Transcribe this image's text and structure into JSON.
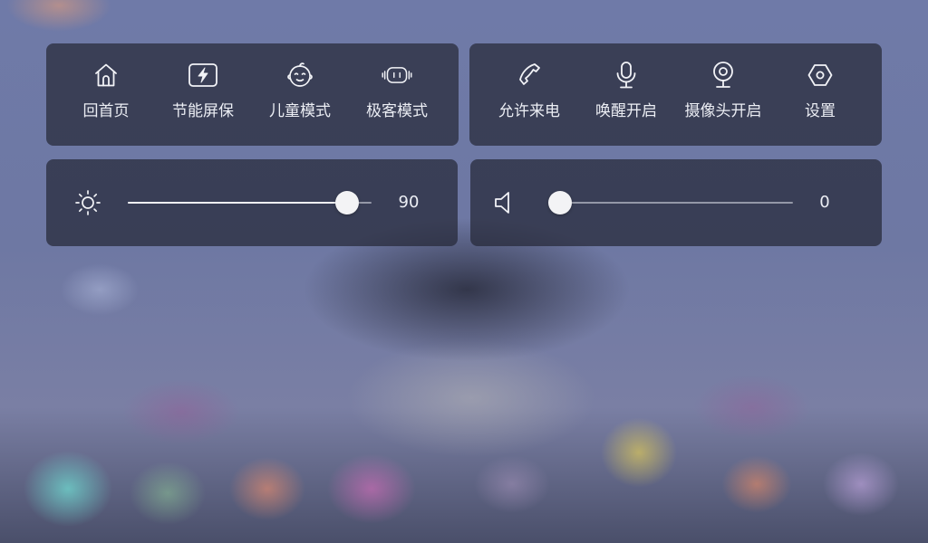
{
  "theme": {
    "panel_bg": "#262838",
    "text_color": "#eceef4",
    "icon_color": "#f2f3f7",
    "slider_fill": "#f2f3f7",
    "slider_track": "#d2d4de",
    "thumb_color": "#f3f3f5"
  },
  "shortcuts_left": [
    {
      "label": "回首页",
      "icon": "home-icon"
    },
    {
      "label": "节能屏保",
      "icon": "energy-saving-icon"
    },
    {
      "label": "儿童模式",
      "icon": "baby-face-icon"
    },
    {
      "label": "极客模式",
      "icon": "robot-icon"
    }
  ],
  "shortcuts_right": [
    {
      "label": "允许来电",
      "icon": "phone-icon"
    },
    {
      "label": "唤醒开启",
      "icon": "microphone-icon"
    },
    {
      "label": "摄像头开启",
      "icon": "webcam-icon"
    },
    {
      "label": "设置",
      "icon": "hexagon-settings-icon"
    }
  ],
  "brightness": {
    "icon": "sun-icon",
    "value": 90,
    "value_text": "90",
    "max": 100
  },
  "volume": {
    "icon": "speaker-icon",
    "value": 0,
    "value_text": "0",
    "max": 100
  }
}
